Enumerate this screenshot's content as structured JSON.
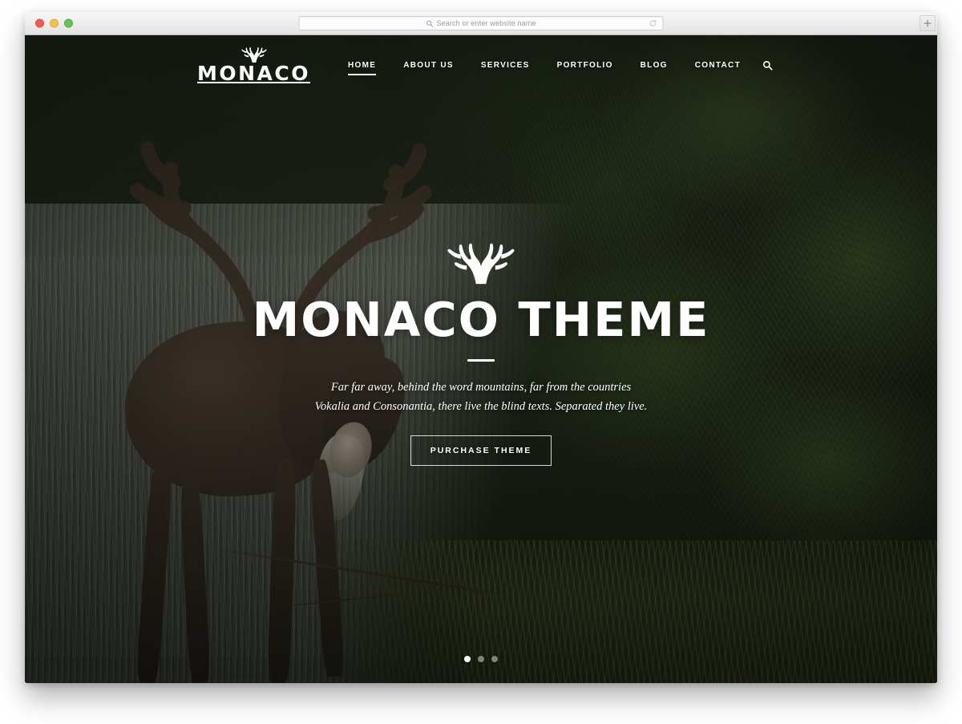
{
  "browser": {
    "traffic_lights": [
      "close",
      "minimize",
      "zoom"
    ],
    "address_placeholder": "Search or enter website name",
    "address_value": "",
    "search_icon": "search-icon",
    "reload_icon": "reload-icon",
    "new_tab_label": "+"
  },
  "site": {
    "brand": {
      "name": "MONACO",
      "icon": "antlers-icon"
    },
    "nav": [
      {
        "label": "HOME",
        "active": true
      },
      {
        "label": "ABOUT US",
        "active": false
      },
      {
        "label": "SERVICES",
        "active": false
      },
      {
        "label": "PORTFOLIO",
        "active": false
      },
      {
        "label": "BLOG",
        "active": false
      },
      {
        "label": "CONTACT",
        "active": false
      }
    ],
    "nav_search_icon": "search-icon"
  },
  "hero": {
    "icon": "antlers-icon",
    "title": "MONACO THEME",
    "subtitle": "Far far away, behind the word mountains, far from the countries Vokalia and Consonantia, there live the blind texts. Separated they live.",
    "button_label": "PURCHASE THEME",
    "slider": {
      "count": 3,
      "active_index": 0
    }
  },
  "colors": {
    "text_on_hero": "#ffffff",
    "page_background": "#ffffff",
    "chrome_background": "#ececec",
    "traffic_red": "#f6594f",
    "traffic_yellow": "#f7bd4d",
    "traffic_green": "#62c654",
    "hero_dark": "#1d2118",
    "foliage_green": "#3a5224"
  }
}
